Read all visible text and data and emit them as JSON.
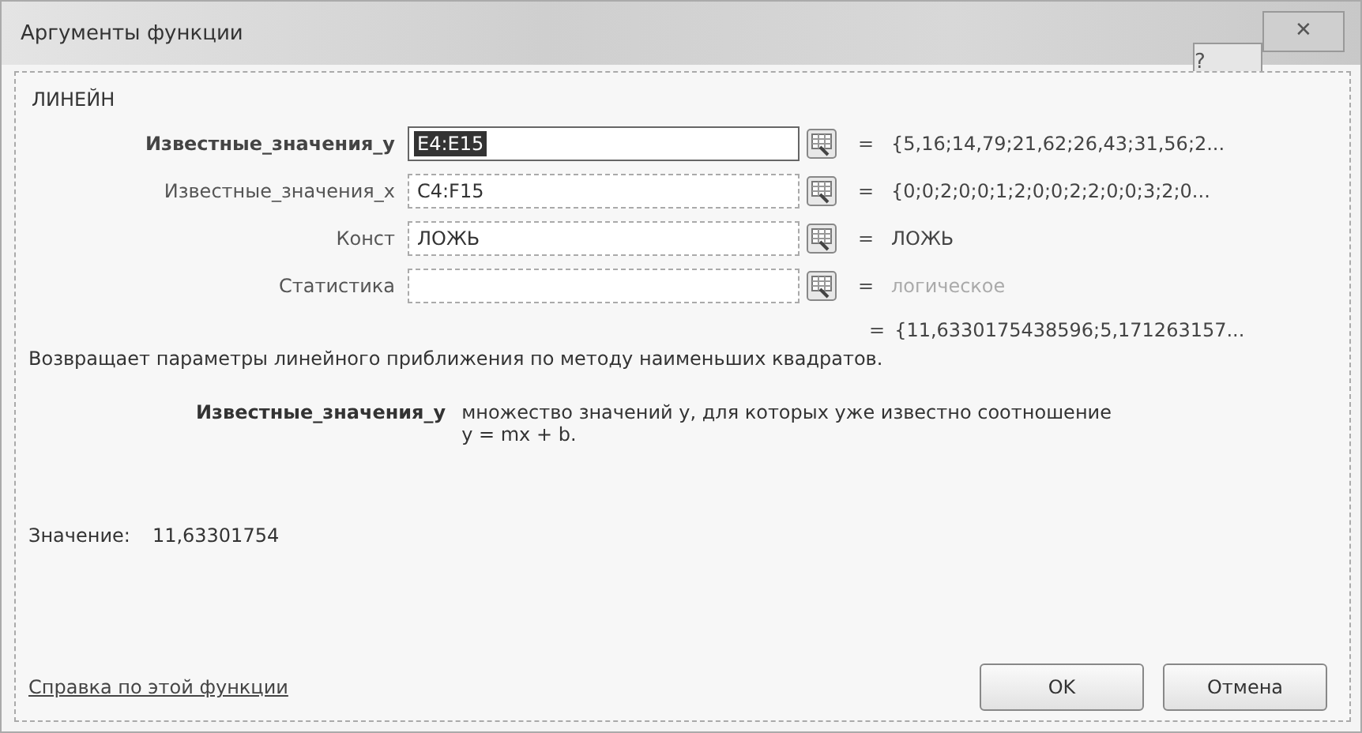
{
  "window": {
    "title": "Аргументы функции",
    "buttons": [
      "?",
      "✕"
    ]
  },
  "function_name": "ЛИНЕЙН",
  "arguments": [
    {
      "label": "Известные_значения_y",
      "value": "E4:E15",
      "selected": true,
      "equals": "=",
      "result": "{5,16;14,79;21,62;26,43;31,56;2...",
      "disabled": false
    },
    {
      "label": "Известные_значения_x",
      "value": "C4:F15",
      "selected": false,
      "equals": "=",
      "result": "{0;0;2;0;0;1;2;0;0;2;2;0;0;3;2;0...",
      "disabled": false
    },
    {
      "label": "Конст",
      "value": "ЛОЖЬ",
      "selected": false,
      "equals": "=",
      "result": "ЛОЖЬ",
      "disabled": false
    },
    {
      "label": "Статистика",
      "selected": false,
      "equals": "=",
      "result": "логическое",
      "disabled": true
    }
  ],
  "total": {
    "equals": "=",
    "result": "{11,6330175438596;5,171263157..."
  },
  "description": "Возвращает параметры линейного приближения по методу наименьших квадратов.",
  "argument_help": {
    "name": "Известные_значения_y",
    "text": "множество значений y, для которых уже известно соотношение y = mx + b."
  },
  "value": {
    "label": "Значение:",
    "text": "11,63301754"
  },
  "help_link": "Справка по этой функции",
  "buttons": [
    "OK",
    "Отмена"
  ]
}
